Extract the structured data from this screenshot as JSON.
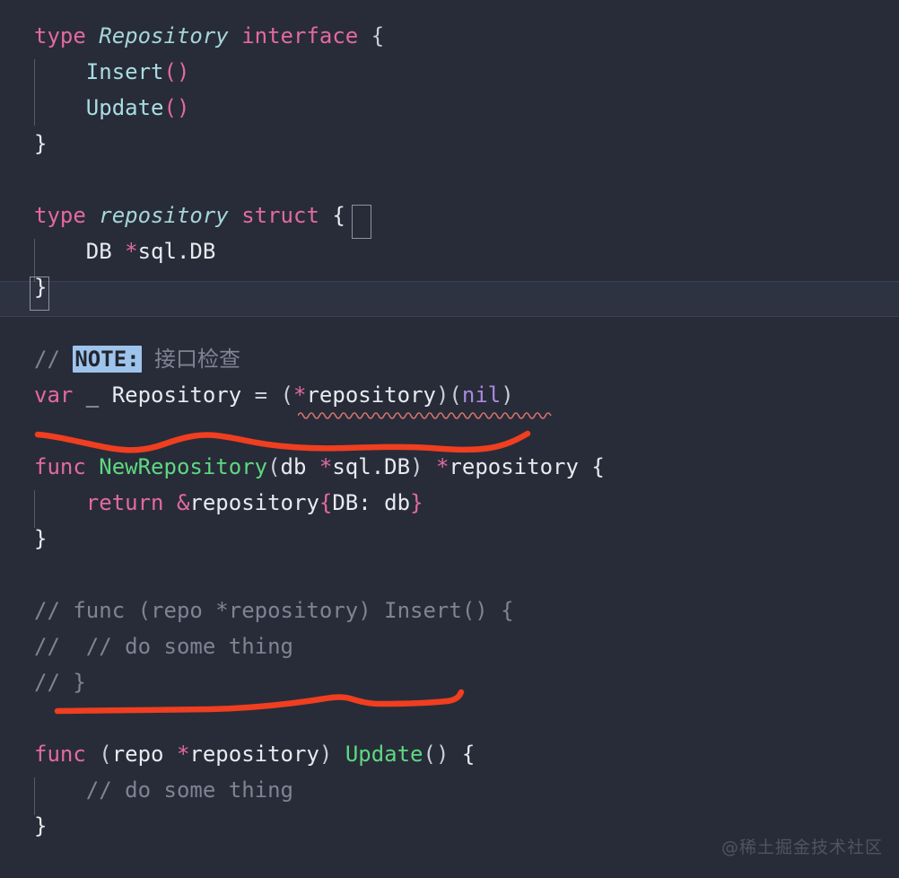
{
  "editor": {
    "background_color": "#282c38",
    "active_line_color": "#2e3342",
    "annotation_color": "#f03e20",
    "note_highlight_color": "#9fc4ec",
    "squiggle_color": "#d4736e",
    "watermark": "@稀土掘金技术社区"
  },
  "code": {
    "lines": [
      {
        "n": 1,
        "indent": 0,
        "text": "type Repository interface {"
      },
      {
        "n": 2,
        "indent": 1,
        "text": "Insert()"
      },
      {
        "n": 3,
        "indent": 1,
        "text": "Update()"
      },
      {
        "n": 4,
        "indent": 0,
        "text": "}"
      },
      {
        "n": 5,
        "indent": 0,
        "text": ""
      },
      {
        "n": 6,
        "indent": 0,
        "text": "type repository struct {"
      },
      {
        "n": 7,
        "indent": 1,
        "text": "DB *sql.DB"
      },
      {
        "n": 8,
        "indent": 0,
        "text": "}"
      },
      {
        "n": 9,
        "indent": 0,
        "text": ""
      },
      {
        "n": 10,
        "indent": 0,
        "text": "// NOTE: 接口检查"
      },
      {
        "n": 11,
        "indent": 0,
        "text": "var _ Repository = (*repository)(nil)"
      },
      {
        "n": 12,
        "indent": 0,
        "text": ""
      },
      {
        "n": 13,
        "indent": 0,
        "text": "func NewRepository(db *sql.DB) *repository {"
      },
      {
        "n": 14,
        "indent": 1,
        "text": "return &repository{DB: db}"
      },
      {
        "n": 15,
        "indent": 0,
        "text": "}"
      },
      {
        "n": 16,
        "indent": 0,
        "text": ""
      },
      {
        "n": 17,
        "indent": 0,
        "text": ""
      },
      {
        "n": 18,
        "indent": 0,
        "text": "// func (repo *repository) Insert() {"
      },
      {
        "n": 19,
        "indent": 0,
        "text": "//  // do some thing"
      },
      {
        "n": 20,
        "indent": 0,
        "text": "// }"
      },
      {
        "n": 21,
        "indent": 0,
        "text": ""
      },
      {
        "n": 22,
        "indent": 0,
        "text": ""
      },
      {
        "n": 23,
        "indent": 0,
        "text": "func (repo *repository) Update() {"
      },
      {
        "n": 24,
        "indent": 1,
        "text": "// do some thing"
      },
      {
        "n": 25,
        "indent": 0,
        "text": "}"
      }
    ],
    "tokens": {
      "l1_type": "type",
      "l1_name": "Repository",
      "l1_interface": "interface",
      "l1_open": "{",
      "l2_method": "Insert",
      "l2_parens": "()",
      "l3_method": "Update",
      "l3_parens": "()",
      "l4_close": "}",
      "l6_type": "type",
      "l6_name": "repository",
      "l6_struct": "struct",
      "l6_open": "{",
      "l7_field": "DB ",
      "l7_star": "*",
      "l7_fieldtype": "sql.DB",
      "l8_close": "}",
      "l10_slashes": "// ",
      "l10_note": "NOTE:",
      "l10_rest": " 接口检查",
      "l11_var": "var",
      "l11_blank": " _ Repository ",
      "l11_eq": "= ",
      "l11_open": "(",
      "l11_star": "*",
      "l11_ident": "repository",
      "l11_mid": ")(",
      "l11_nil": "nil",
      "l11_close": ")",
      "l13_func": "func",
      "l13_name": "NewRepository",
      "l13_popen": "(",
      "l13_arg": "db ",
      "l13_star": "*",
      "l13_argtype": "sql.DB",
      "l13_pclose": ") ",
      "l13_rstar": "*",
      "l13_ret": "repository",
      "l13_brace": " {",
      "l14_return": "return",
      "l14_amp": "&",
      "l14_ident": "repository",
      "l14_bopen": "{",
      "l14_field": "DB: db",
      "l14_bclose": "}",
      "l15_close": "}",
      "l18_comment": "// func (repo *repository) Insert() {",
      "l19_comment": "//  // do some thing",
      "l20_comment": "// }",
      "l23_func": "func",
      "l23_popen": " (",
      "l23_recv": "repo ",
      "l23_star": "*",
      "l23_recvtype": "repository",
      "l23_pclose": ") ",
      "l23_name": "Update",
      "l23_parens": "()",
      "l23_brace": " {",
      "l24_comment": "// do some thing",
      "l25_close": "}"
    }
  },
  "annotations": {
    "underline_1_label": "red-underline-under-var-repository-nil",
    "underline_2_label": "red-underline-under-commented-insert-block"
  }
}
